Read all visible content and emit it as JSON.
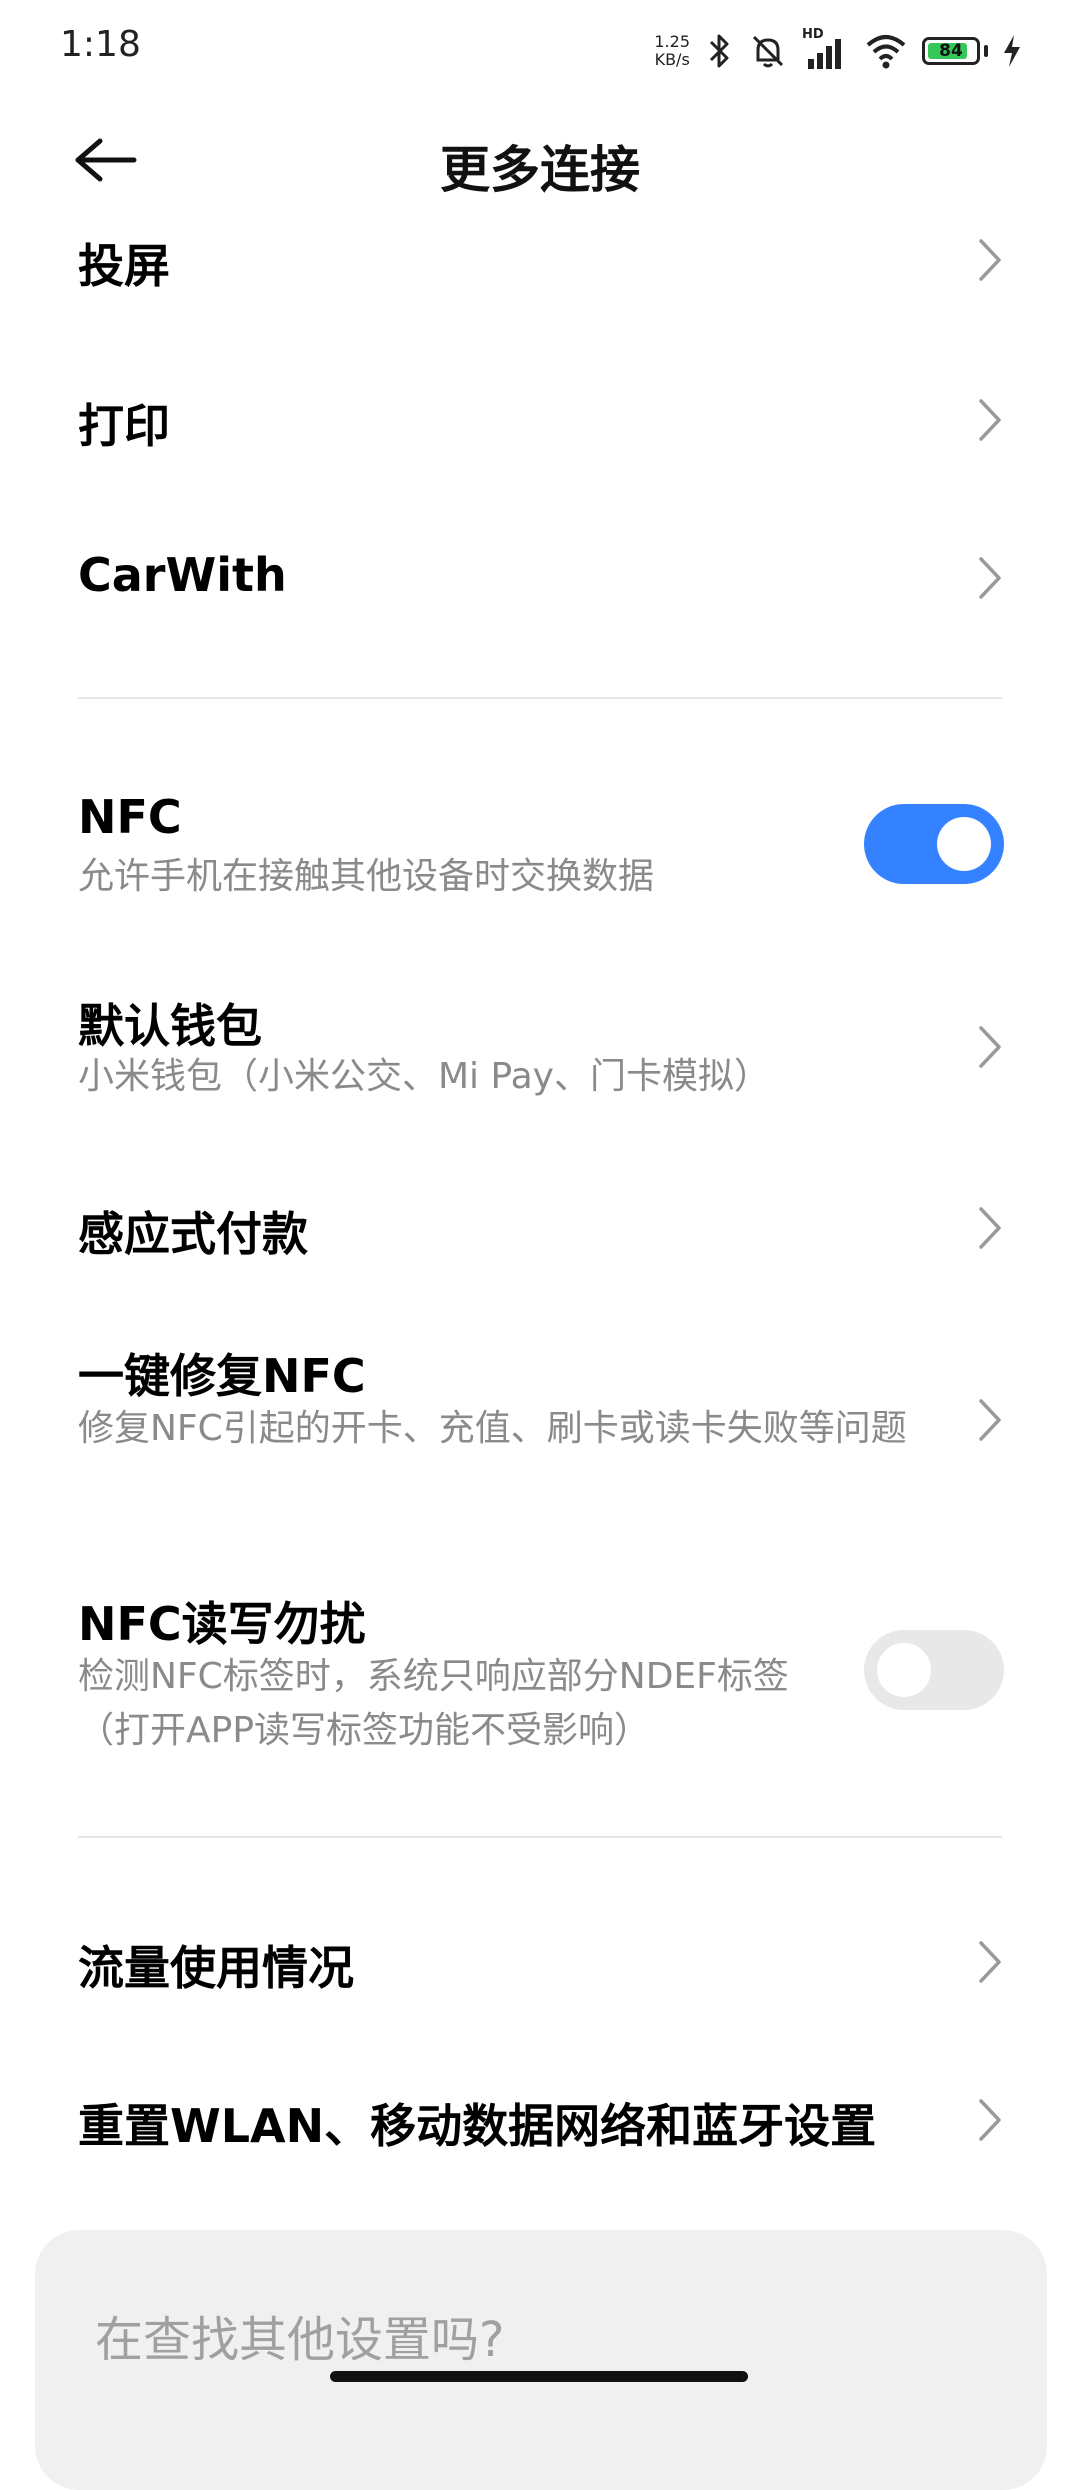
{
  "status": {
    "time": "1:18",
    "net_speed_value": "1.25",
    "net_speed_unit": "KB/s",
    "hd_label": "HD",
    "battery_level": "84",
    "battery_fraction": 0.84
  },
  "header": {
    "title": "更多连接",
    "back_icon": "arrow-left-icon"
  },
  "items": {
    "cast": {
      "title": "投屏"
    },
    "print": {
      "title": "打印"
    },
    "carwith": {
      "title": "CarWith"
    },
    "nfc": {
      "title": "NFC",
      "subtitle": "允许手机在接触其他设备时交换数据",
      "enabled": true
    },
    "default_wallet": {
      "title": "默认钱包",
      "subtitle": "小米钱包（小米公交、Mi Pay、门卡模拟）"
    },
    "tap_to_pay": {
      "title": "感应式付款"
    },
    "repair_nfc": {
      "title": "一键修复NFC",
      "subtitle": "修复NFC引起的开卡、充值、刷卡或读卡失败等问题"
    },
    "nfc_dnd": {
      "title": "NFC读写勿扰",
      "subtitle": "检测NFC标签时，系统只响应部分NDEF标签（打开APP读写标签功能不受影响）",
      "enabled": false
    },
    "data_usage": {
      "title": "流量使用情况"
    },
    "reset_network": {
      "title": "重置WLAN、移动数据网络和蓝牙设置"
    }
  },
  "search": {
    "placeholder": "在查找其他设置吗?"
  },
  "colors": {
    "accent": "#3482ff",
    "toggle_off": "#e8e8e8",
    "subtitle": "#8a8a8a",
    "card_bg": "#f0f0f0"
  }
}
